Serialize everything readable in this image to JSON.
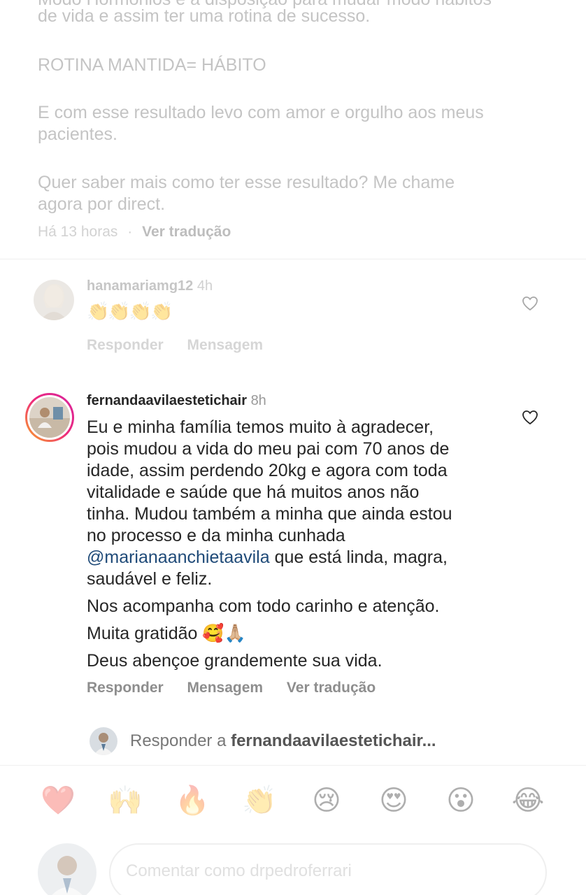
{
  "caption": {
    "cut_line": "Modo Hormônios e a disposição para mudar modo hábitos",
    "line1": "de vida e assim ter uma rotina de sucesso.",
    "line2": "ROTINA MANTIDA= HÁBITO",
    "line3": "E com esse resultado levo com amor e orgulho aos meus",
    "line4": "pacientes.",
    "line5": "Quer saber mais como ter esse resultado? Me chame",
    "line6": "agora por direct.",
    "time": "Há 13 horas",
    "separator": "·",
    "translate": "Ver tradução"
  },
  "comments": [
    {
      "username": "hanamariamg12",
      "time": "4h",
      "text": "👏👏👏👏",
      "reply": "Responder",
      "message": "Mensagem"
    },
    {
      "username": "fernandaavilaestetichair",
      "time": "8h",
      "lines": [
        "Eu e minha família temos muito à agradecer,",
        "pois mudou a vida do meu pai com 70 anos de",
        "idade, assim perdendo 20kg e agora com toda",
        "vitalidade e saúde que há muitos anos não",
        "tinha. Mudou também a minha que ainda estou",
        "no processo e da minha cunhada"
      ],
      "mention": "@marianaanchietaavila",
      "mention_rest": " que está linda, magra,",
      "line_after": "saudável e feliz.",
      "line_p2": "Nos acompanha com todo carinho e atenção.",
      "line_p3": "Muita gratidão 🥰🙏🏼",
      "line_p4": "Deus abençoe grandemente sua vida.",
      "reply": "Responder",
      "message": "Mensagem",
      "translate": "Ver tradução"
    }
  ],
  "reply_bar": {
    "prefix": "Responder a ",
    "target": "fernandaavilaestetichair..."
  },
  "emoji_reactions": [
    "❤️",
    "🙌",
    "🔥",
    "👏",
    "😢",
    "😍",
    "😮",
    "😂"
  ],
  "compose": {
    "placeholder": "Comentar como drpedroferrari"
  },
  "colors": {
    "mention": "#1f4a78",
    "secondary": "#8e8e8e",
    "story_ring_start": "#f9a825",
    "story_ring_end": "#d6249f"
  }
}
